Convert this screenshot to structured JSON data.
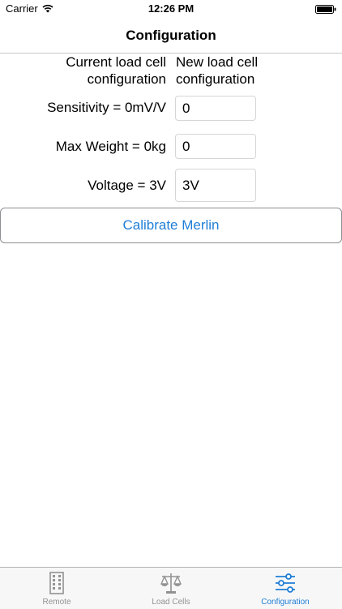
{
  "status": {
    "carrier": "Carrier",
    "time": "12:26 PM"
  },
  "nav": {
    "title": "Configuration"
  },
  "columns": {
    "current": "Current load cell configuration",
    "new": "New load cell configuration"
  },
  "rows": [
    {
      "label": "Sensitivity = 0mV/V",
      "value": "0"
    },
    {
      "label": "Max Weight = 0kg",
      "value": "0"
    },
    {
      "label": "Voltage = 3V",
      "value": "3V"
    }
  ],
  "calibrate_label": "Calibrate Merlin",
  "tabs": [
    {
      "label": "Remote",
      "icon": "building-icon"
    },
    {
      "label": "Load Cells",
      "icon": "scale-icon"
    },
    {
      "label": "Configuration",
      "icon": "sliders-icon",
      "active": true
    }
  ],
  "colors": {
    "accent": "#1f7ed6",
    "inactive_tab": "#929292"
  }
}
